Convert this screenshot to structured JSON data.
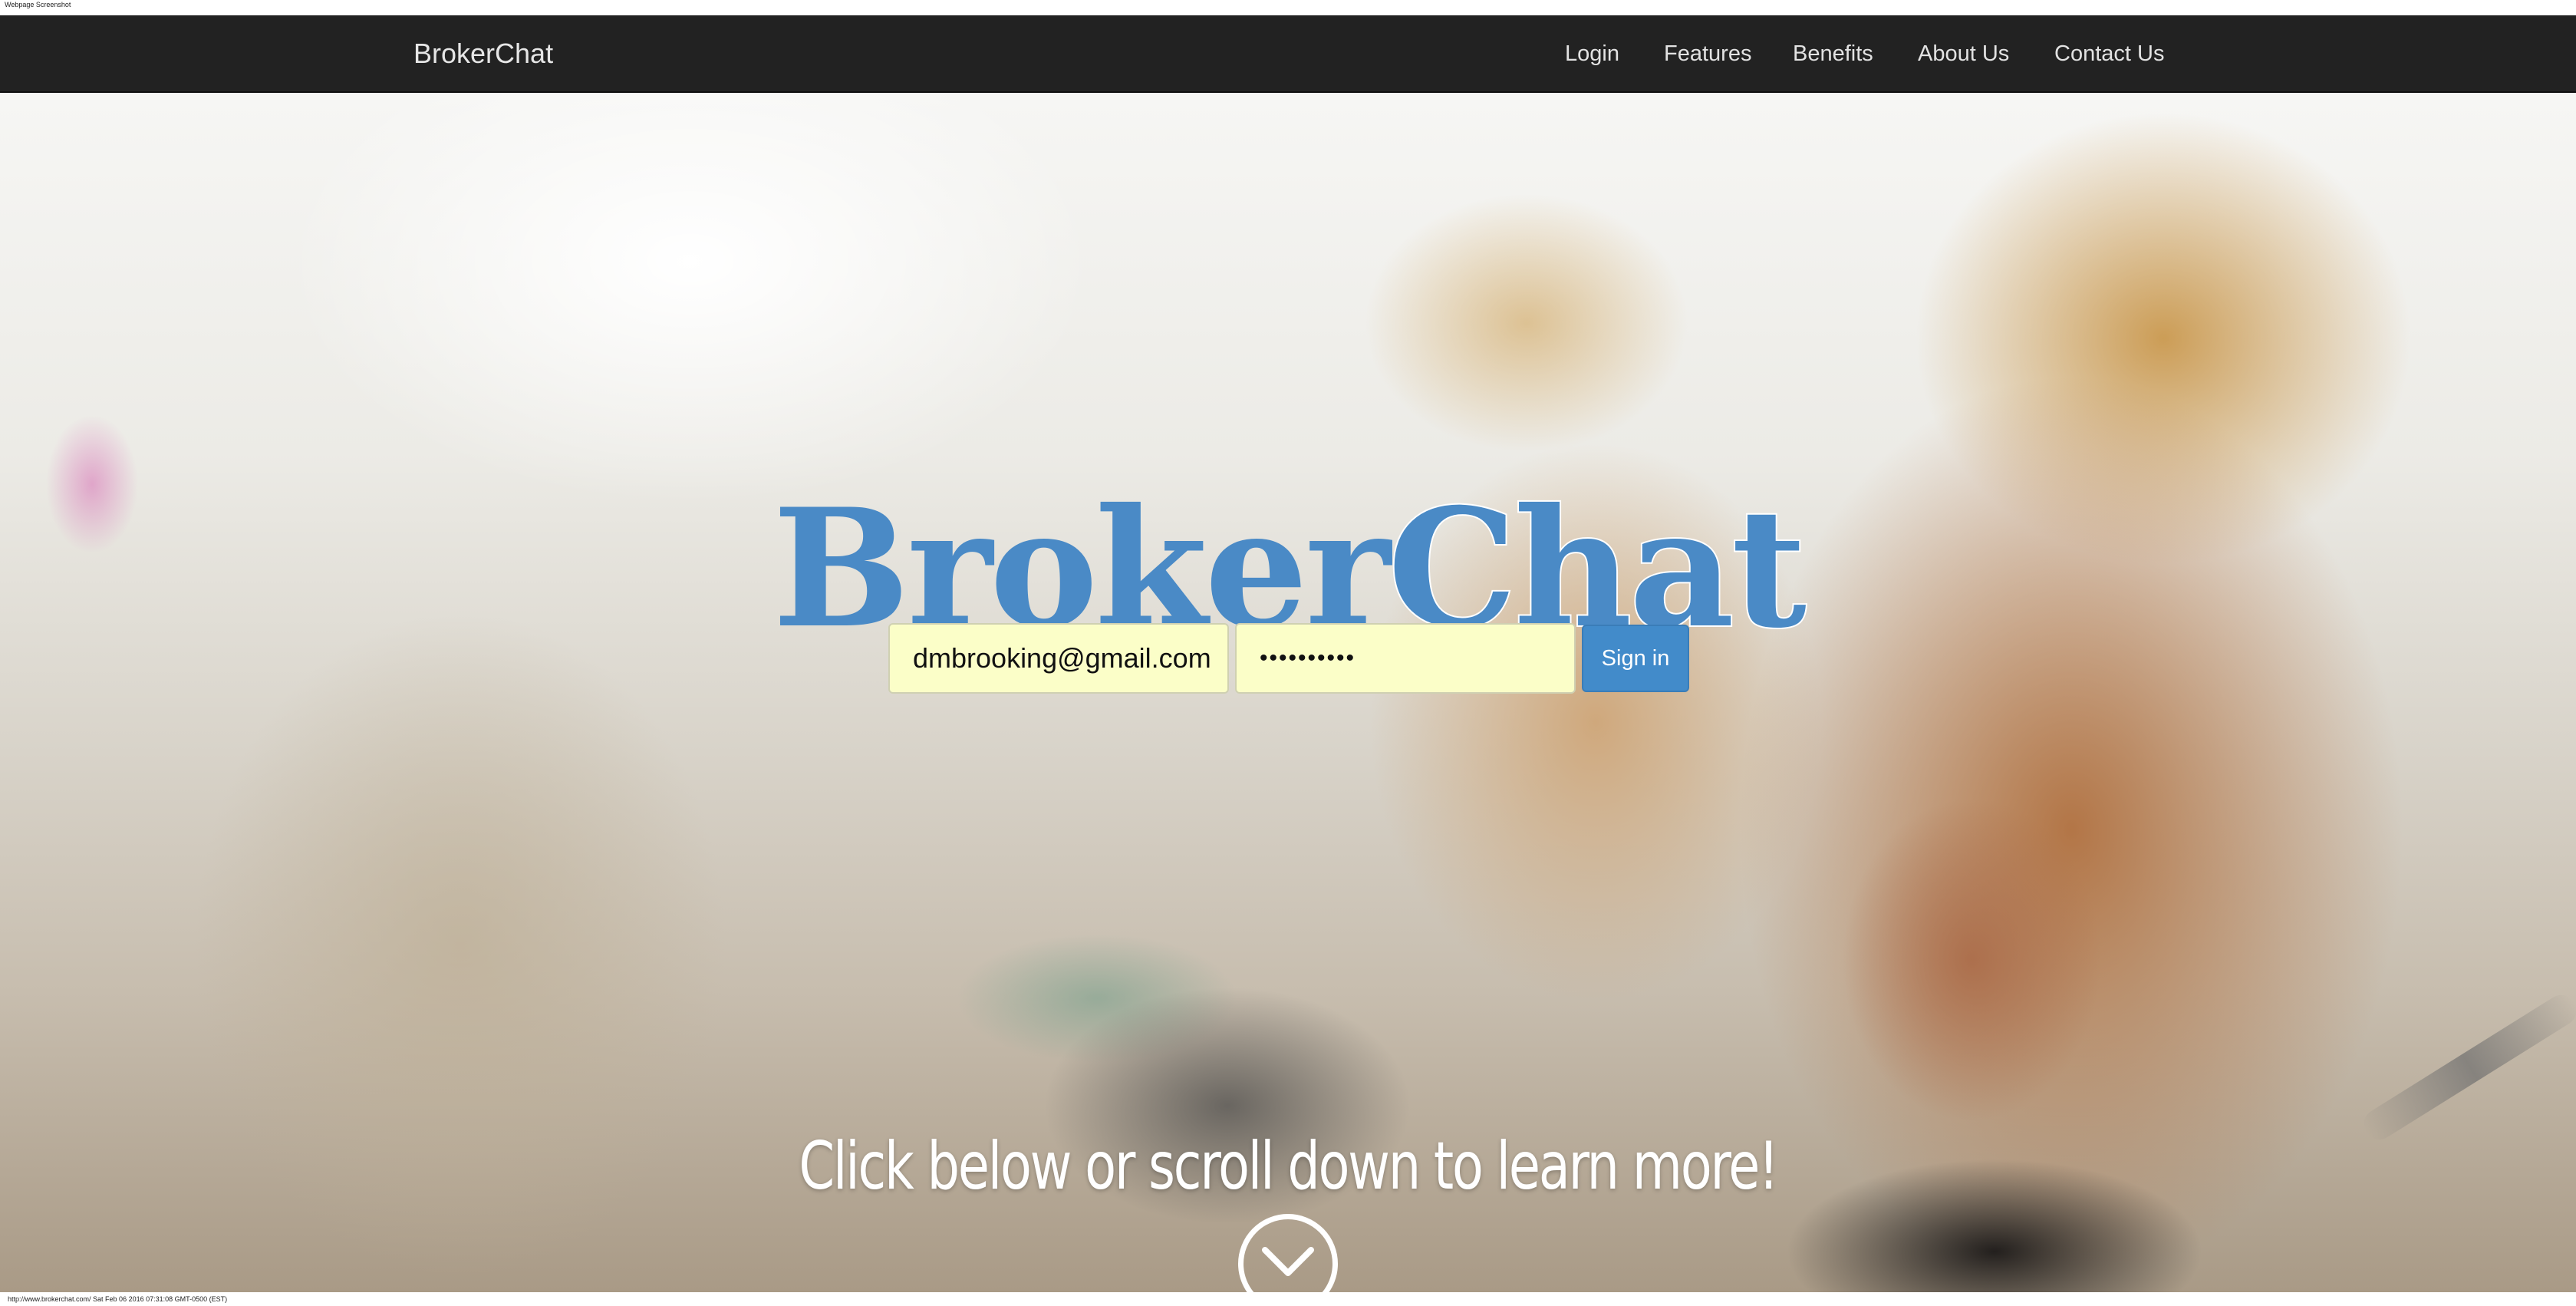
{
  "caption": "Webpage Screenshot",
  "navbar": {
    "brand": "BrokerChat",
    "links": [
      "Login",
      "Features",
      "Benefits",
      "About Us",
      "Contact Us"
    ]
  },
  "hero": {
    "logo_part1": "Broker",
    "logo_part2": "Chat",
    "email_value": "dmbrooking@gmail.com",
    "password_value": "••••••••••",
    "sign_in_label": "Sign in",
    "cta": "Click below or scroll down to learn more!",
    "scroll_icon": "chevron-down-circle-icon"
  },
  "footer": {
    "status": "http://www.brokerchat.com/ Sat Feb 06 2016 07:31:08 GMT-0500 (EST)"
  },
  "colors": {
    "navbar_bg": "#222222",
    "brand_blue": "#4a8ac6",
    "button_blue": "#428bca",
    "autofill_yellow": "#fbfec8"
  }
}
